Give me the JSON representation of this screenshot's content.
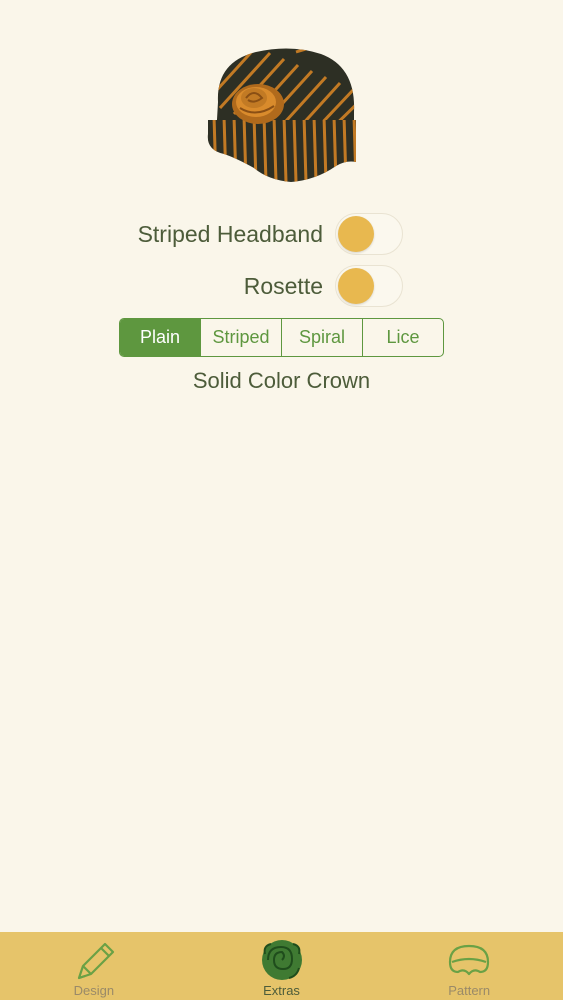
{
  "preview": {
    "image": "hat-preview-image"
  },
  "options": {
    "striped_headband": {
      "label": "Striped Headband",
      "on": false
    },
    "rosette": {
      "label": "Rosette",
      "on": false
    }
  },
  "crown_style": {
    "segments": [
      "Plain",
      "Striped",
      "Spiral",
      "Lice"
    ],
    "selected": "Plain",
    "description": "Solid Color Crown"
  },
  "tabbar": {
    "tabs": [
      {
        "label": "Design",
        "icon": "pencil-icon",
        "active": false
      },
      {
        "label": "Extras",
        "icon": "rosette-icon",
        "active": true
      },
      {
        "label": "Pattern",
        "icon": "hat-icon",
        "active": false
      }
    ]
  },
  "colors": {
    "background": "#faf6ea",
    "accent_green": "#5e973f",
    "toggle_knob": "#e8b84f",
    "tabbar": "#e6c46a"
  }
}
